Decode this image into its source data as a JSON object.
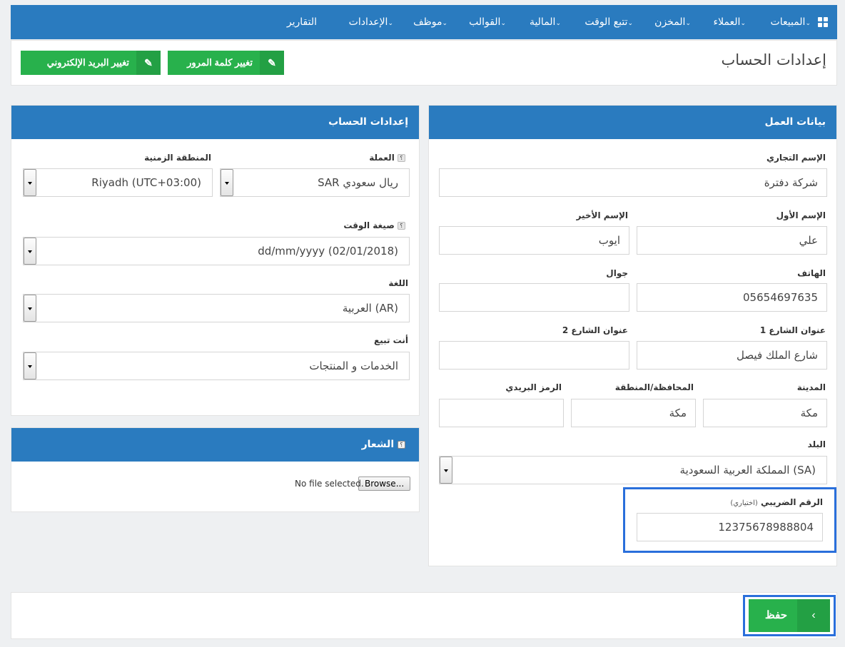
{
  "nav": {
    "items": [
      {
        "label": "المبيعات",
        "dropdown": true
      },
      {
        "label": "العملاء",
        "dropdown": true
      },
      {
        "label": "المخزن",
        "dropdown": true
      },
      {
        "label": "تتبع الوقت",
        "dropdown": true
      },
      {
        "label": "المالية",
        "dropdown": true
      },
      {
        "label": "القوالب",
        "dropdown": true
      },
      {
        "label": "موظف",
        "dropdown": true
      },
      {
        "label": "الإعدادات",
        "dropdown": true
      },
      {
        "label": "التقارير",
        "dropdown": false
      }
    ],
    "chevron": "⌄"
  },
  "header": {
    "title": "إعدادات الحساب",
    "change_password": "تغيير كلمة المرور",
    "change_email": "تغيير البريد الإلكتروني",
    "edit_icon": "✎"
  },
  "business": {
    "title": "بيانات العمل",
    "trade_name_label": "الإسم التجاري",
    "trade_name": "شركة دفترة",
    "first_name_label": "الإسم الأول",
    "first_name": "علي",
    "last_name_label": "الإسم الأخير",
    "last_name": "ايوب",
    "phone_label": "الهاتف",
    "phone": "05654697635",
    "mobile_label": "جوال",
    "mobile": "",
    "street1_label": "عنوان الشارع 1",
    "street1": "شارع الملك فيصل",
    "street2_label": "عنوان الشارع 2",
    "street2": "",
    "city_label": "المدينة",
    "city": "مكة",
    "region_label": "المحافظة/المنطقة",
    "region": "مكة",
    "postal_label": "الرمز البريدي",
    "postal": "",
    "country_label": "البلد",
    "country": "المملكة العربية السعودية (SA)",
    "tax_label": "الرقم الضريبي",
    "tax_optional": "(اختياري)",
    "tax": "12375678988804"
  },
  "account": {
    "title": "إعدادات الحساب",
    "currency_label": "العملة",
    "currency": "SAR ريال سعودي",
    "timezone_label": "المنطقة الزمنية",
    "timezone": "Riyadh (UTC+03:00)",
    "time_format_label": "صيغة الوقت",
    "time_format": "dd/mm/yyyy (02/01/2018)",
    "language_label": "اللغة",
    "language": "العربية (AR)",
    "follow_label": "أنت تبيع",
    "follow": "الخدمات و المنتجات",
    "help_glyph": "؟"
  },
  "logo": {
    "title": "الشعار",
    "browse": "Browse...",
    "no_file": "No file selected."
  },
  "footer": {
    "save": "حفظ",
    "arrow": "‹"
  },
  "colors": {
    "primary": "#2a7bbf",
    "success": "#28b14c",
    "highlight": "#2a6fdb"
  }
}
